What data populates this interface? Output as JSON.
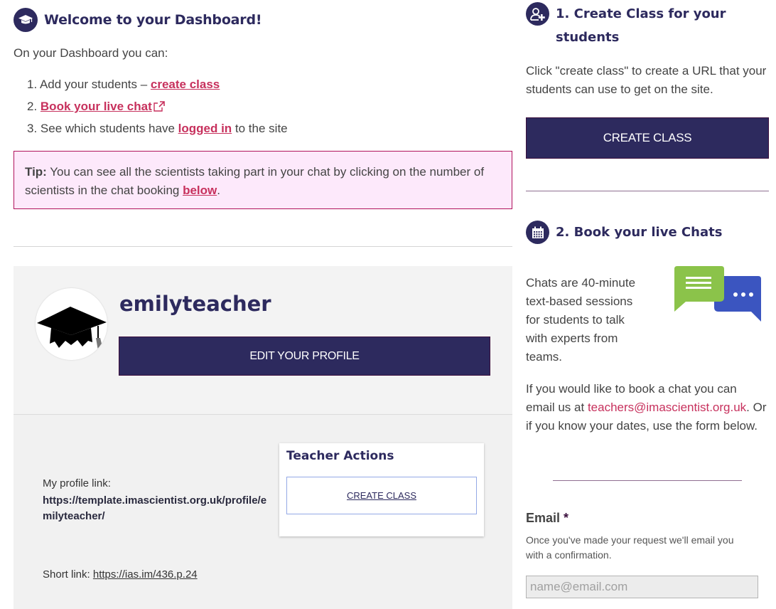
{
  "welcome": {
    "icon": "graduation-cap-icon",
    "title": "Welcome to your Dashboard!",
    "intro": "On your Dashboard you can:",
    "steps": [
      {
        "prefix": "1. Add your students – ",
        "link": "create class",
        "suffix": ""
      },
      {
        "prefix": "2. ",
        "link": "Book your live chat",
        "suffix": "",
        "icon": "external-link-icon"
      },
      {
        "prefix": "3. See which students have ",
        "link": "logged in",
        "suffix": " to the site"
      }
    ]
  },
  "tip": {
    "label": "Tip:",
    "text": " You can see all the scientists taking part in your chat by clicking on the number of scientists in the chat booking ",
    "link": "below",
    "end": "."
  },
  "profile": {
    "username": "emilyteacher",
    "avatar": "graduation-cap-avatar",
    "edit_button": "EDIT YOUR PROFILE",
    "profile_link_label": "My profile link:",
    "profile_link_url": "https://template.imascientist.org.uk/profile/emilyteacher/",
    "short_link_label": "Short link: ",
    "short_link_url": "https://ias.im/436.p.24"
  },
  "teacher_actions": {
    "title": "Teacher Actions",
    "create_class": "CREATE CLASS"
  },
  "sidebar": {
    "create_class": {
      "icon": "add-user-icon",
      "title_line1": "1. Create Class for your",
      "title_line2": "students",
      "text": "Click \"create class\" to create a URL that your students can use to get on the site.",
      "button": "CREATE CLASS"
    },
    "book_chats": {
      "icon": "calendar-icon",
      "title": "2. Book your live Chats",
      "description": "Chats are 40-minute text-based sessions for students to talk with experts from teams.",
      "illustration": "chat-bubbles-icon",
      "booking_text_before": "If you would like to book a chat you can email us at ",
      "booking_email": "teachers@imascientist.org.uk",
      "booking_text_after": ". Or if you know your dates, use the form below."
    },
    "form": {
      "email_label": "Email",
      "required_mark": "*",
      "email_help": "Once you've made your request we'll email you with a confirmation.",
      "email_placeholder": "name@email.com",
      "email_value": ""
    }
  },
  "colors": {
    "brand_navy": "#2d2a5e",
    "link_pink": "#c7315d",
    "tip_bg": "#fde9fb",
    "tip_border": "#b0125c",
    "chat_green": "#8bc34a",
    "chat_blue": "#3b55c0"
  }
}
